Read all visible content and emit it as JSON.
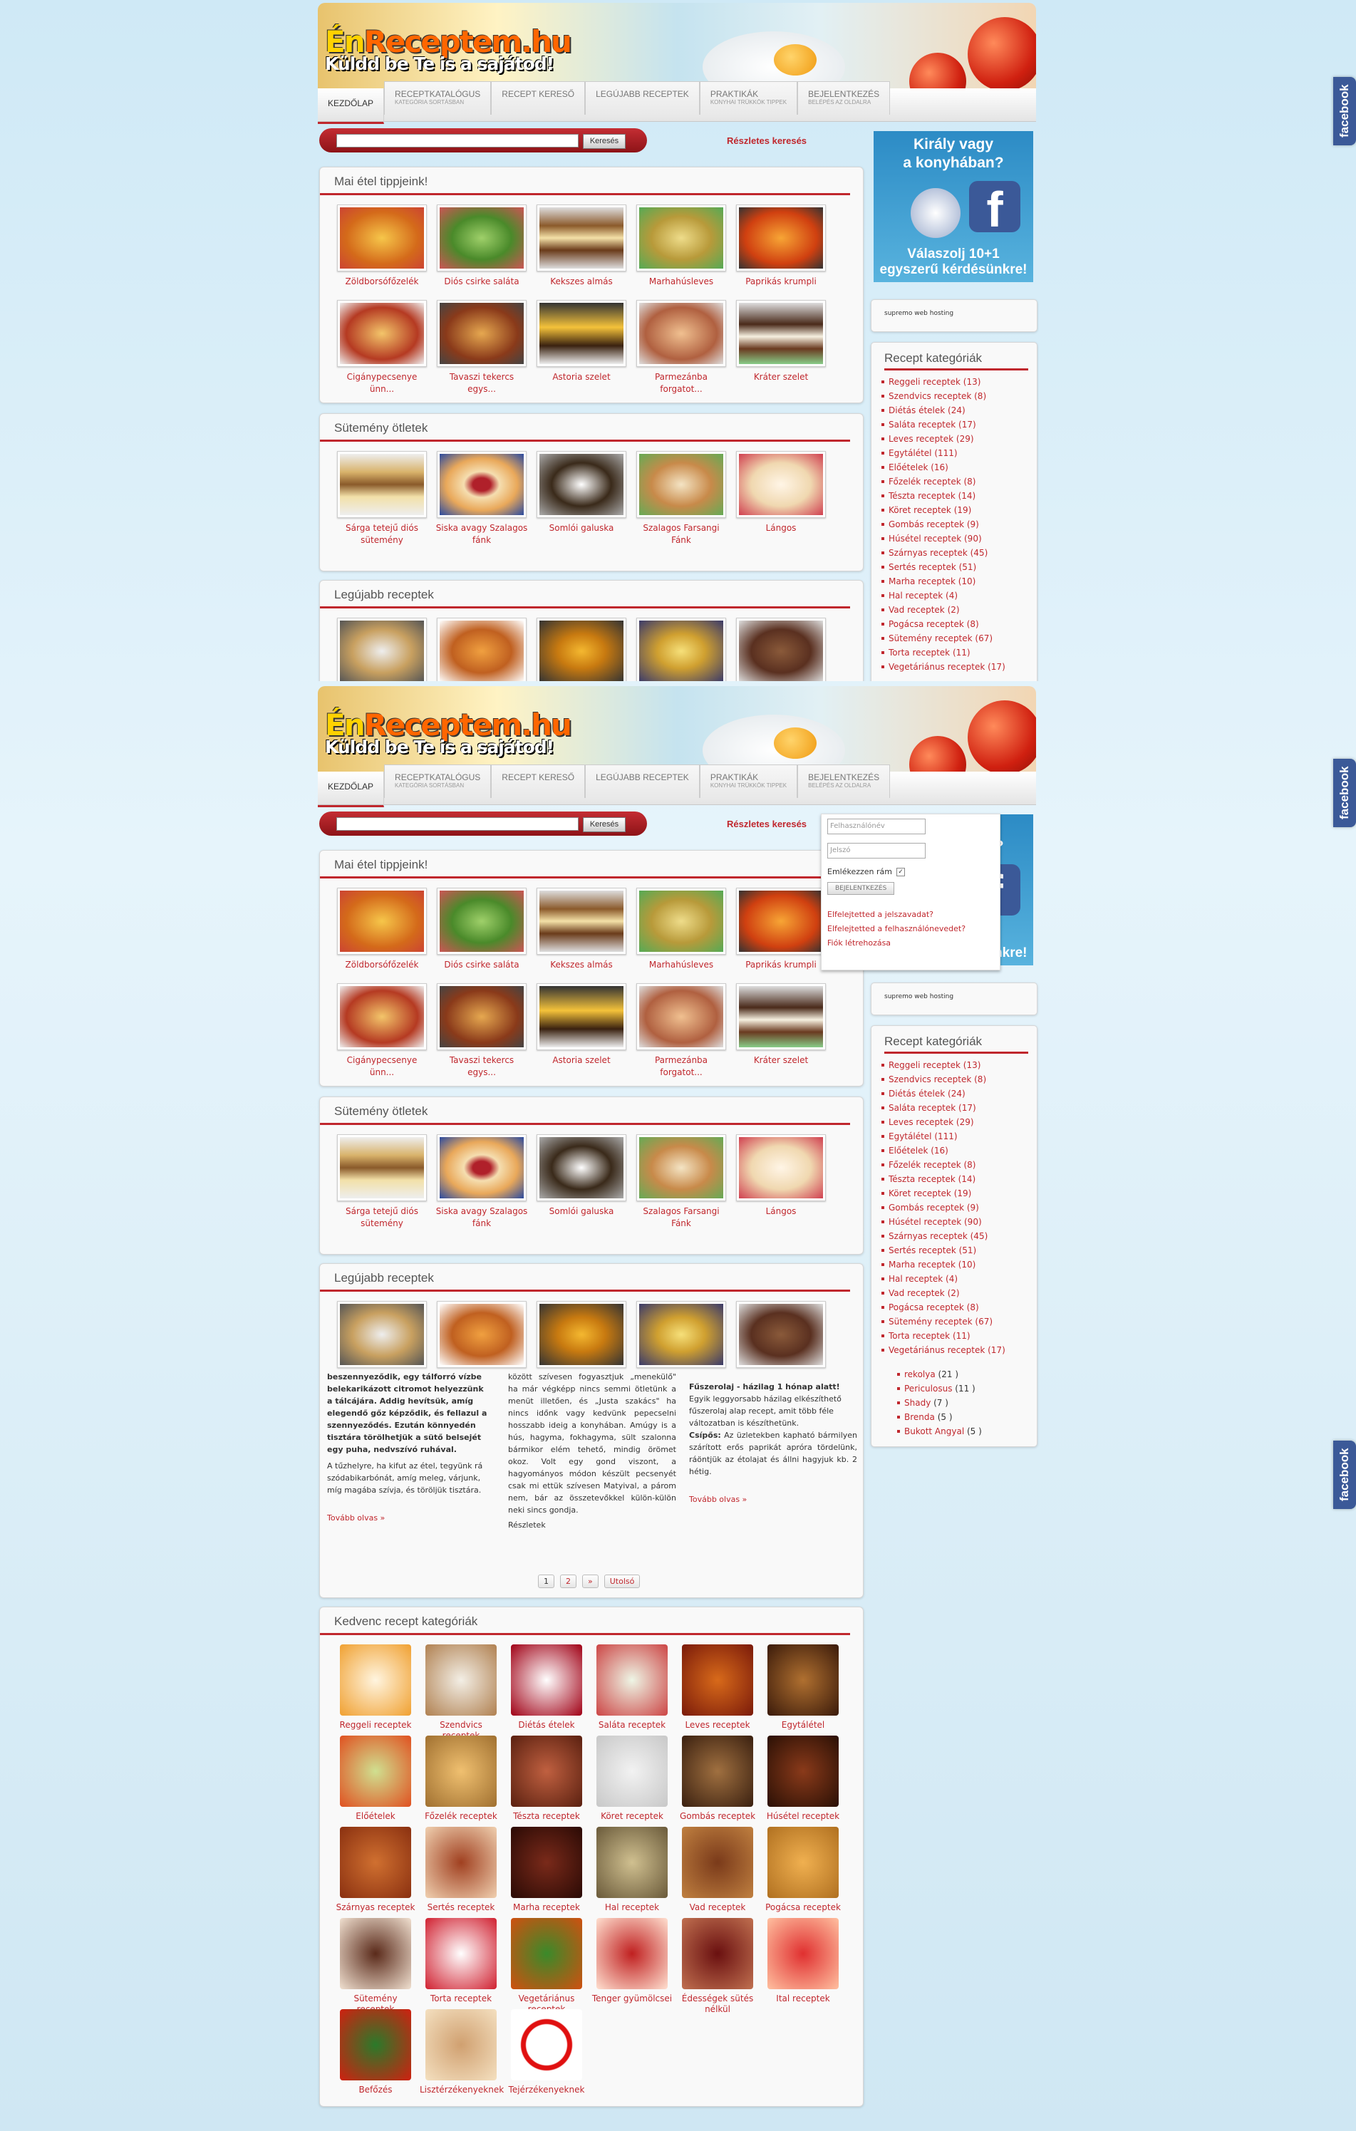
{
  "site": {
    "logo_line1_a": "Én",
    "logo_line1_b": "Receptem.hu",
    "logo_line2": "Küldd be Te is a sajátod!"
  },
  "nav": [
    {
      "label": "KEZDŐLAP",
      "sub": ""
    },
    {
      "label": "RECEPTKATALÓGUS",
      "sub": "KATEGÓRIA SORTÁSBAN"
    },
    {
      "label": "RECEPT KERESŐ",
      "sub": ""
    },
    {
      "label": "LEGÚJABB RECEPTEK",
      "sub": ""
    },
    {
      "label": "PRAKTIKÁK",
      "sub": "KONYHAI TRÜKKÖK TIPPEK"
    },
    {
      "label": "BEJELENTKEZÉS",
      "sub": "BELÉPÉS AZ OLDALRA"
    }
  ],
  "search": {
    "button": "Keresés",
    "advanced": "Részletes keresés"
  },
  "sections": {
    "tips_title": "Mai étel tippjeink!",
    "tips": [
      "Zöldborsófőzelék",
      "Diós csirke saláta",
      "Kekszes almás",
      "Marhahúsleves",
      "Paprikás krumpli",
      "Cigánypecsenye ünn...",
      "Tavaszi tekercs egys...",
      "Astoria szelet",
      "Parmezánba forgatot...",
      "Kráter szelet"
    ],
    "cakes_title": "Sütemény ötletek",
    "cakes": [
      "Sárga tetejű diós sütemény",
      "Siska avagy Szalagos fánk",
      "Somlói galuska",
      "Szalagos Farsangi Fánk",
      "Lángos"
    ],
    "newest_title": "Legújabb receptek",
    "favorites_title": "Kedvenc recept kategóriák",
    "favorites": [
      "Reggeli receptek",
      "Szendvics receptek",
      "Diétás ételek",
      "Saláta receptek",
      "Leves receptek",
      "Egytálétel",
      "Előételek",
      "Főzelék receptek",
      "Tészta receptek",
      "Köret receptek",
      "Gombás receptek",
      "Húsétel receptek",
      "Szárnyas receptek",
      "Sertés receptek",
      "Marha receptek",
      "Hal receptek",
      "Vad receptek",
      "Pogácsa receptek",
      "Sütemény receptek",
      "Torta receptek",
      "Vegetáriánus receptek",
      "Tenger gyümölcsei",
      "Édességek sütés nélkül",
      "Ital receptek",
      "Befőzés",
      "Lisztérzékenyeknek",
      "Tejérzékenyeknek"
    ]
  },
  "sidebar": {
    "banner_line1": "Király vagy",
    "banner_line2": "a konyhában?",
    "banner_line3": "Válaszolj 10+1",
    "banner_line4": "egyszerű kérdésünkre!",
    "hosting": "supremo web hosting",
    "categories_title": "Recept kategóriák",
    "categories": [
      "Reggeli receptek (13)",
      "Szendvics receptek (8)",
      "Diétás ételek (24)",
      "Saláta receptek (17)",
      "Leves receptek (29)",
      "Egytálétel (111)",
      "Előételek (16)",
      "Főzelék receptek (8)",
      "Tészta receptek (14)",
      "Köret receptek (19)",
      "Gombás receptek (9)",
      "Húsétel receptek (90)",
      "Szárnyas receptek (45)",
      "Sertés receptek (51)",
      "Marha receptek (10)",
      "Hal receptek (4)",
      "Vad receptek (2)",
      "Pogácsa receptek (8)",
      "Sütemény receptek (67)",
      "Torta receptek (11)",
      "Vegetáriánus receptek (17)"
    ],
    "users": [
      {
        "name": "rekolya",
        "count": "(21 )"
      },
      {
        "name": "Periculosus",
        "count": "(11 )"
      },
      {
        "name": "Shady",
        "count": "(7 )"
      },
      {
        "name": "Brenda",
        "count": "(5 )"
      },
      {
        "name": "Bukott Angyal",
        "count": "(5 )"
      }
    ]
  },
  "login": {
    "username_placeholder": "Felhasználónév",
    "password_placeholder": "Jelszó",
    "remember": "Emlékezzen rám",
    "button": "BEJELENTKEZÉS",
    "forgot_password": "Elfelejtetted a jelszavadat?",
    "forgot_username": "Elfelejtetted a felhasználónevedet?",
    "create_account": "Fiók létrehozása"
  },
  "articles": {
    "a1_text": "beszennyeződik, egy tálforró vízbe belekarikázott citromot helyezzünk a tálcájára. Addig hevítsük, amíg elegendő gőz képződik, és fellazul a szennyeződés. Ezután könnyedén tisztára törölhetjük a sütő belsejét egy puha, nedvszívó ruhával.",
    "a1_text2": "A tűzhelyre, ha kifut az étel, tegyünk rá szódabikarbónát, amíg meleg, várjunk, míg magába szívja, és töröljük tisztára.",
    "a1_more": "Tovább olvas »",
    "a2_text": "között szívesen fogyasztjuk „menekülő\" ha már végképp nincs semmi ötletünk a menüt illetően, és „Justa szakács\" ha nincs időnk vagy kedvünk pepecselni hosszabb ideig a konyhában. Amúgy is a hús, hagyma, fokhagyma, sült szalonna bármikor elém tehető, mindig örömet okoz. Volt egy gond viszont, a hagyományos módon készült pecsenyét csak mi ettük szívesen Matyival, a párom nem, bár az összetevőkkel külön-külön neki sincs gondja.",
    "a2_more": "Részletek",
    "a3_title": "Fűszerolaj - házilag 1 hónap alatt!",
    "a3_text": "Egyik leggyorsabb házilag elkészíthető fűszerolaj alap recept, amit több féle változatban is készíthetünk.",
    "a3_bold": "Csípős:",
    "a3_text2": "Az üzletekben kapható bármilyen szárított erős paprikát apróra tördelünk, ráöntjük az étolajat és állni hagyjuk kb. 2 hétig.",
    "a3_more": "Tovább olvas »"
  },
  "pager": [
    "1",
    "2",
    "»",
    "Utolsó"
  ],
  "colors": {
    "accent": "#c0272d",
    "facebook": "#3b5998"
  }
}
